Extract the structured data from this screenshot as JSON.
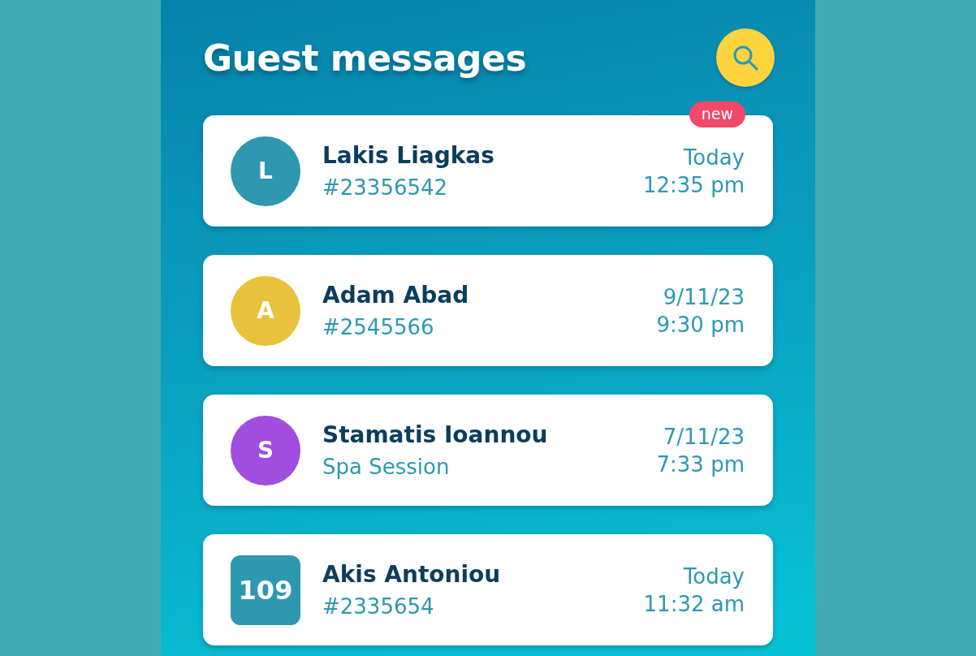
{
  "header": {
    "title": "Guest messages"
  },
  "messages": [
    {
      "name": "Lakis Liagkas",
      "subtitle": "#23356542",
      "date": "Today",
      "time": "12:35 pm",
      "badge": "new",
      "avatar": {
        "kind": "circle",
        "text": "L",
        "color": "#2e98b0"
      }
    },
    {
      "name": "Adam Abad",
      "subtitle": "#2545566",
      "date": "9/11/23",
      "time": "9:30 pm",
      "avatar": {
        "kind": "circle",
        "text": "A",
        "color": "#e9c23b"
      }
    },
    {
      "name": "Stamatis Ioannou",
      "subtitle": "Spa Session",
      "date": "7/11/23",
      "time": "7:33 pm",
      "avatar": {
        "kind": "circle",
        "text": "S",
        "color": "#a04de0"
      }
    },
    {
      "name": "Akis Antoniou",
      "subtitle": "#2335654",
      "date": "Today",
      "time": "11:32 am",
      "avatar": {
        "kind": "square",
        "text": "109",
        "color": "#2e98b0"
      }
    }
  ]
}
